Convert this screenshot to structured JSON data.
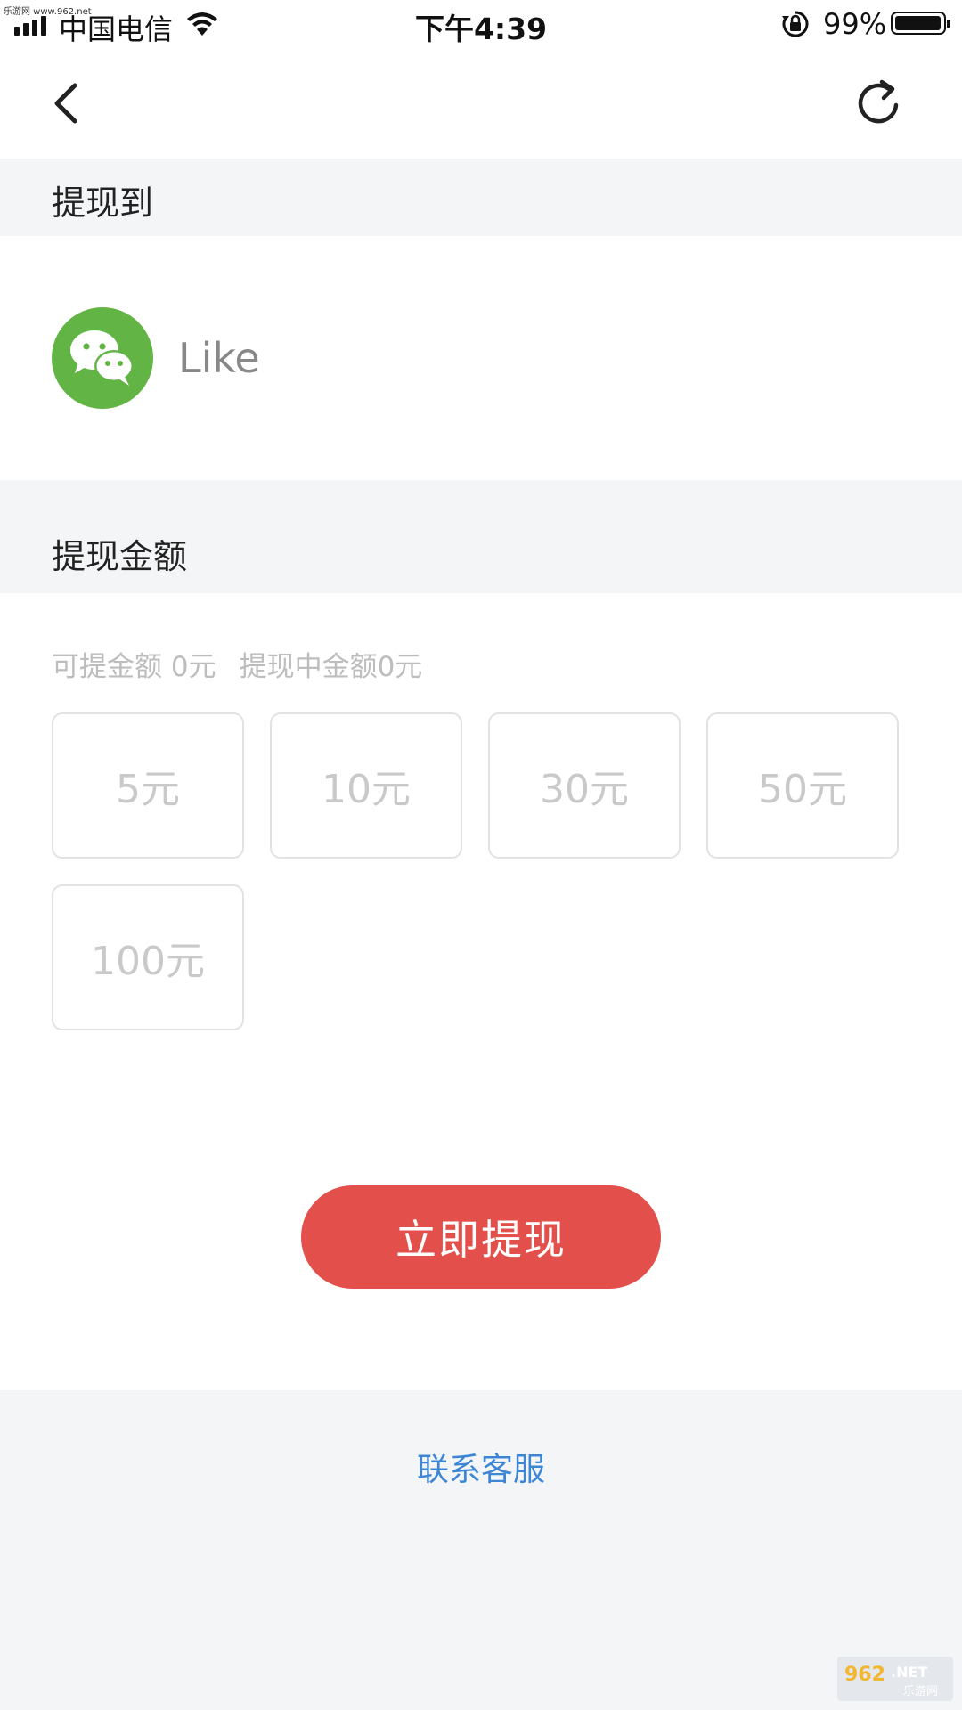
{
  "watermark": {
    "top_text": "乐游网 www.962.net",
    "bottom_text": "962.NET",
    "bottom_subtext": "乐游网"
  },
  "status_bar": {
    "carrier": "中国电信",
    "time": "下午4:39",
    "battery_percent": "99%",
    "battery_level": 0.99,
    "signal_bars": 4
  },
  "nav": {
    "back_icon": "chevron-left-icon",
    "refresh_icon": "refresh-icon"
  },
  "withdraw_to": {
    "title": "提现到",
    "account_icon": "wechat-icon",
    "account_color": "#62b544",
    "account_name": "Like"
  },
  "amount_section": {
    "title": "提现金额",
    "available_label": "可提金额 0元",
    "pending_label": "提现中金额0元",
    "options": [
      "5元",
      "10元",
      "30元",
      "50元",
      "100元"
    ]
  },
  "actions": {
    "withdraw_button": "立即提现",
    "withdraw_color": "#e34f4b"
  },
  "footer": {
    "contact_label": "联系客服",
    "contact_color": "#3d86d6"
  }
}
